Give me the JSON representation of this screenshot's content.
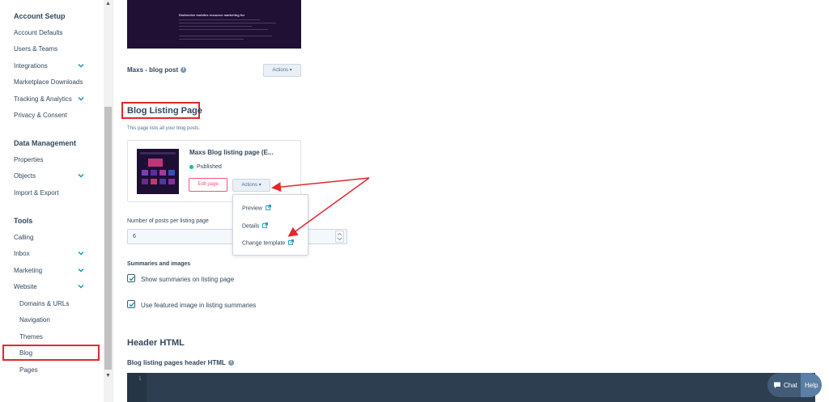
{
  "sidebar": {
    "sections": [
      {
        "heading": "Account Setup",
        "items": [
          {
            "label": "Account Defaults"
          },
          {
            "label": "Users & Teams"
          },
          {
            "label": "Integrations"
          },
          {
            "label": "Marketplace Downloads"
          },
          {
            "label": "Tracking & Analytics"
          },
          {
            "label": "Privacy & Consent"
          }
        ]
      },
      {
        "heading": "Data Management",
        "items": [
          {
            "label": "Properties"
          },
          {
            "label": "Objects"
          },
          {
            "label": "Import & Export"
          }
        ]
      },
      {
        "heading": "Tools",
        "items": [
          {
            "label": "Calling"
          },
          {
            "label": "Inbox"
          },
          {
            "label": "Marketing"
          },
          {
            "label": "Website"
          }
        ],
        "website_children": [
          {
            "label": "Domains & URLs"
          },
          {
            "label": "Navigation"
          },
          {
            "label": "Themes"
          },
          {
            "label": "Blog"
          },
          {
            "label": "Pages"
          }
        ]
      }
    ]
  },
  "post_template": {
    "label": "Maxs - blog post",
    "actions_label": "Actions",
    "hero_title": "Distinctive mobiles resource marketing for"
  },
  "listing": {
    "title": "Blog Listing Page",
    "description": "This page lists all your blog posts.",
    "card_title": "Maxs Blog listing page (E...",
    "status": "Published",
    "edit_label": "Edit page",
    "actions_label": "Actions"
  },
  "actions_menu": {
    "items": [
      "Preview",
      "Details",
      "Change template"
    ]
  },
  "posts_per_page": {
    "label": "Number of posts per listing page",
    "value": "6"
  },
  "summaries": {
    "heading": "Summaries and images",
    "option1": "Show summaries on listing page",
    "option2": "Use featured image in listing summaries"
  },
  "header_html": {
    "title": "Header HTML",
    "field_label": "Blog listing pages header HTML",
    "line_number": "1"
  },
  "floating": {
    "chat": "Chat",
    "help": "Help"
  },
  "colors": {
    "accent_red": "#e5272d",
    "published": "#00bda5",
    "editor_bg": "#2d3e50",
    "checkbox": "#0091ae"
  }
}
